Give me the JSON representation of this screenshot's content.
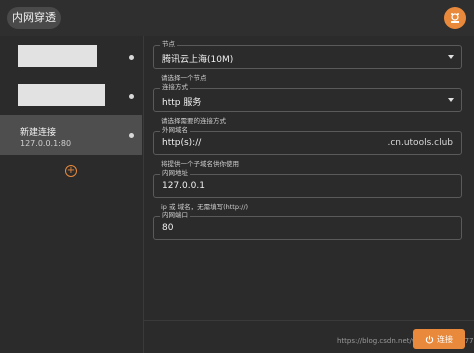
{
  "app": {
    "title": "内网穿透"
  },
  "sidebar": {
    "items": [
      {
        "name": "",
        "address": ""
      },
      {
        "name": "",
        "address": ""
      },
      {
        "name": "新建连接",
        "address": "127.0.0.1:80"
      }
    ],
    "add_icon": "plus-icon"
  },
  "form": {
    "node": {
      "label": "节点",
      "value": "腾讯云上海(10M)",
      "hint": "请选择一个节点"
    },
    "method": {
      "label": "连接方式",
      "value": "http 服务",
      "hint": "请选择需要的连接方式"
    },
    "domain": {
      "label": "外网域名",
      "prefix": "http(s)://",
      "suffix": ".cn.utools.club",
      "hint": "将提供一个子域名供你使用"
    },
    "ip": {
      "label": "内网地址",
      "value": "127.0.0.1",
      "hint": "ip 或 域名，无需填写(http://)"
    },
    "port": {
      "label": "内网端口",
      "value": "80"
    }
  },
  "footer": {
    "connect_label": "连接",
    "watermark": "https://blog.csdn.net/weixin_45437477"
  },
  "colors": {
    "accent": "#e8893c",
    "background": "#2b2b2b"
  }
}
